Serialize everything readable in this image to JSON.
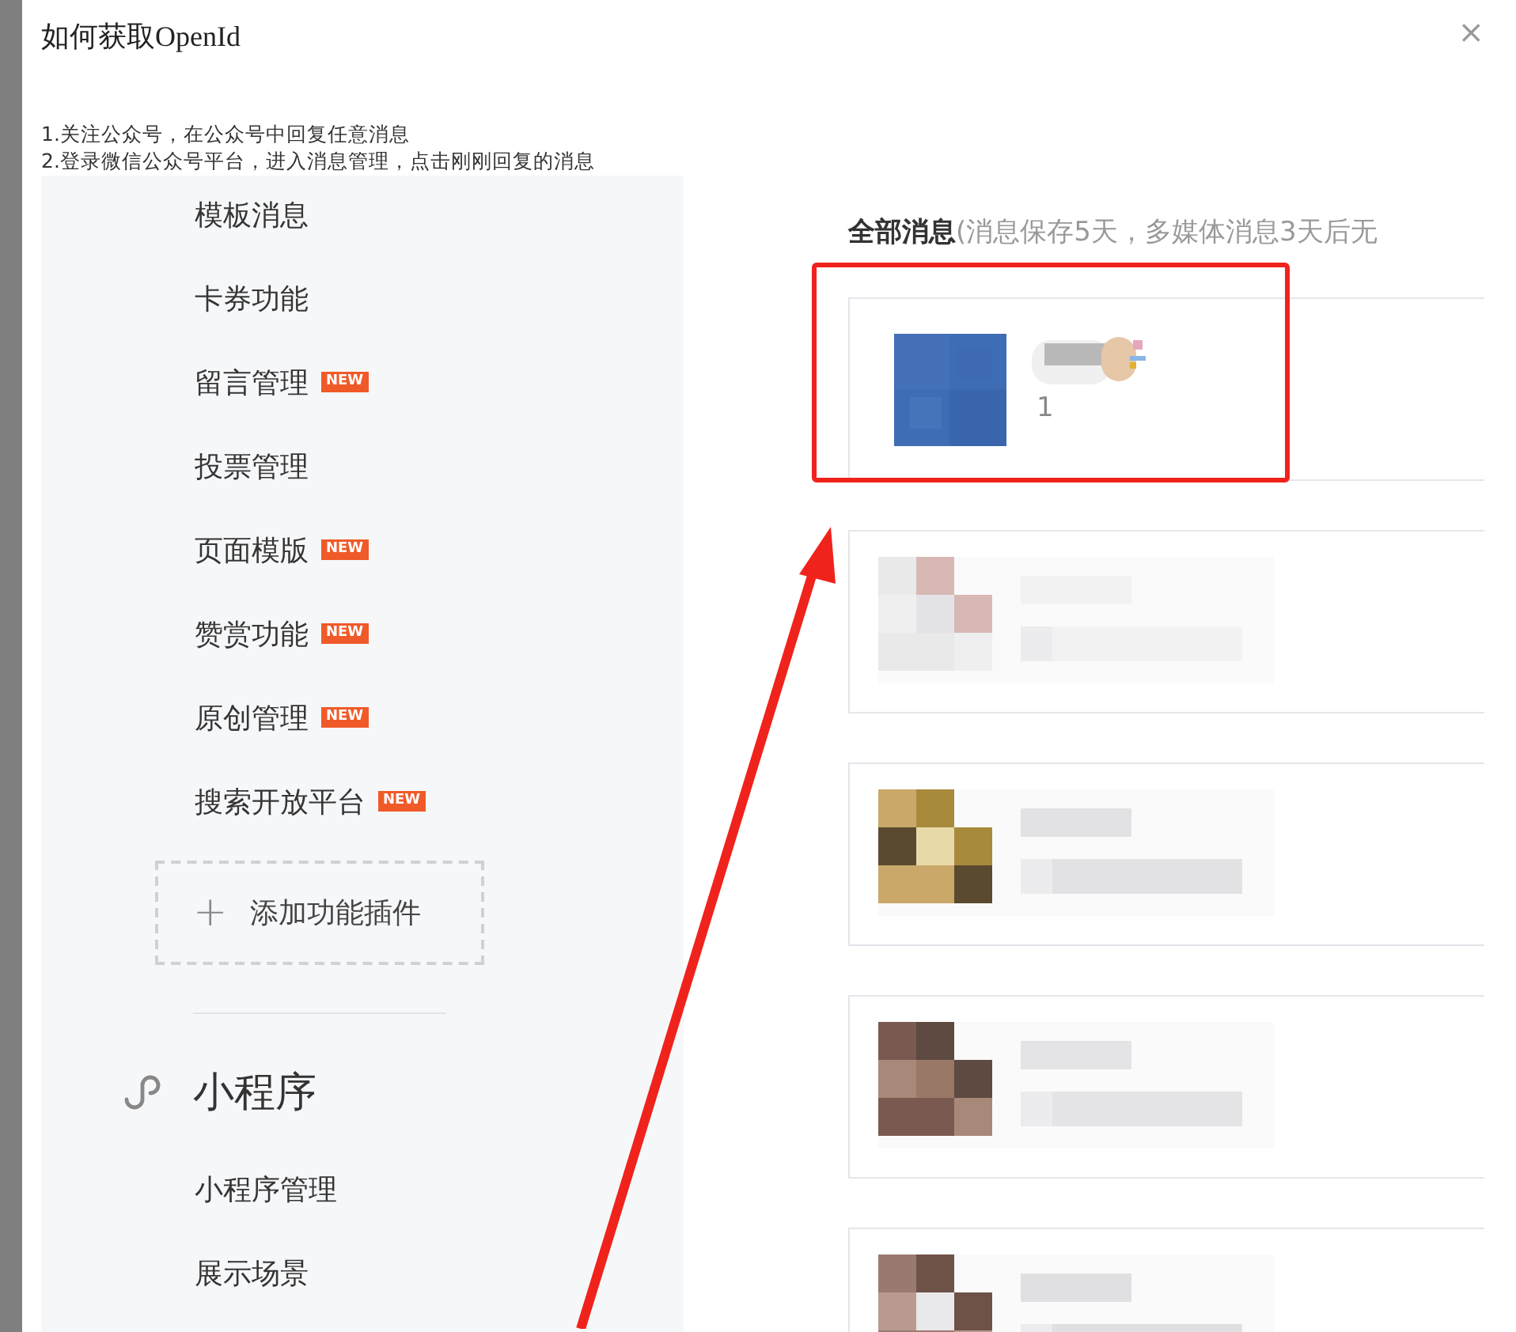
{
  "dialog": {
    "title": "如何获取OpenId",
    "close": "×",
    "steps": [
      "1.关注公众号，在公众号中回复任意消息",
      "2.登录微信公众号平台，进入消息管理，点击刚刚回复的消息"
    ]
  },
  "screenshot": {
    "sidebar": {
      "items": [
        {
          "label": "模板消息"
        },
        {
          "label": "卡券功能"
        },
        {
          "label": "留言管理",
          "badge": "NEW"
        },
        {
          "label": "投票管理"
        },
        {
          "label": "页面模版",
          "badge": "NEW"
        },
        {
          "label": "赞赏功能",
          "badge": "NEW"
        },
        {
          "label": "原创管理",
          "badge": "NEW"
        },
        {
          "label": "搜索开放平台",
          "badge": "NEW"
        }
      ],
      "add_plugin": {
        "icon": "+",
        "label": "添加功能插件"
      },
      "section": {
        "title": "小程序",
        "items": [
          {
            "label": "小程序管理"
          },
          {
            "label": "展示场景"
          }
        ]
      }
    },
    "messages": {
      "heading": "全部消息",
      "note": "(消息保存5天，多媒体消息3天后无",
      "items": [
        {
          "kind": "text",
          "text": "1",
          "highlighted": true
        },
        {
          "kind": "picture",
          "highlighted": false
        },
        {
          "kind": "picture",
          "highlighted": false
        },
        {
          "kind": "picture",
          "highlighted": false
        },
        {
          "kind": "picture",
          "highlighted": false
        }
      ]
    }
  }
}
